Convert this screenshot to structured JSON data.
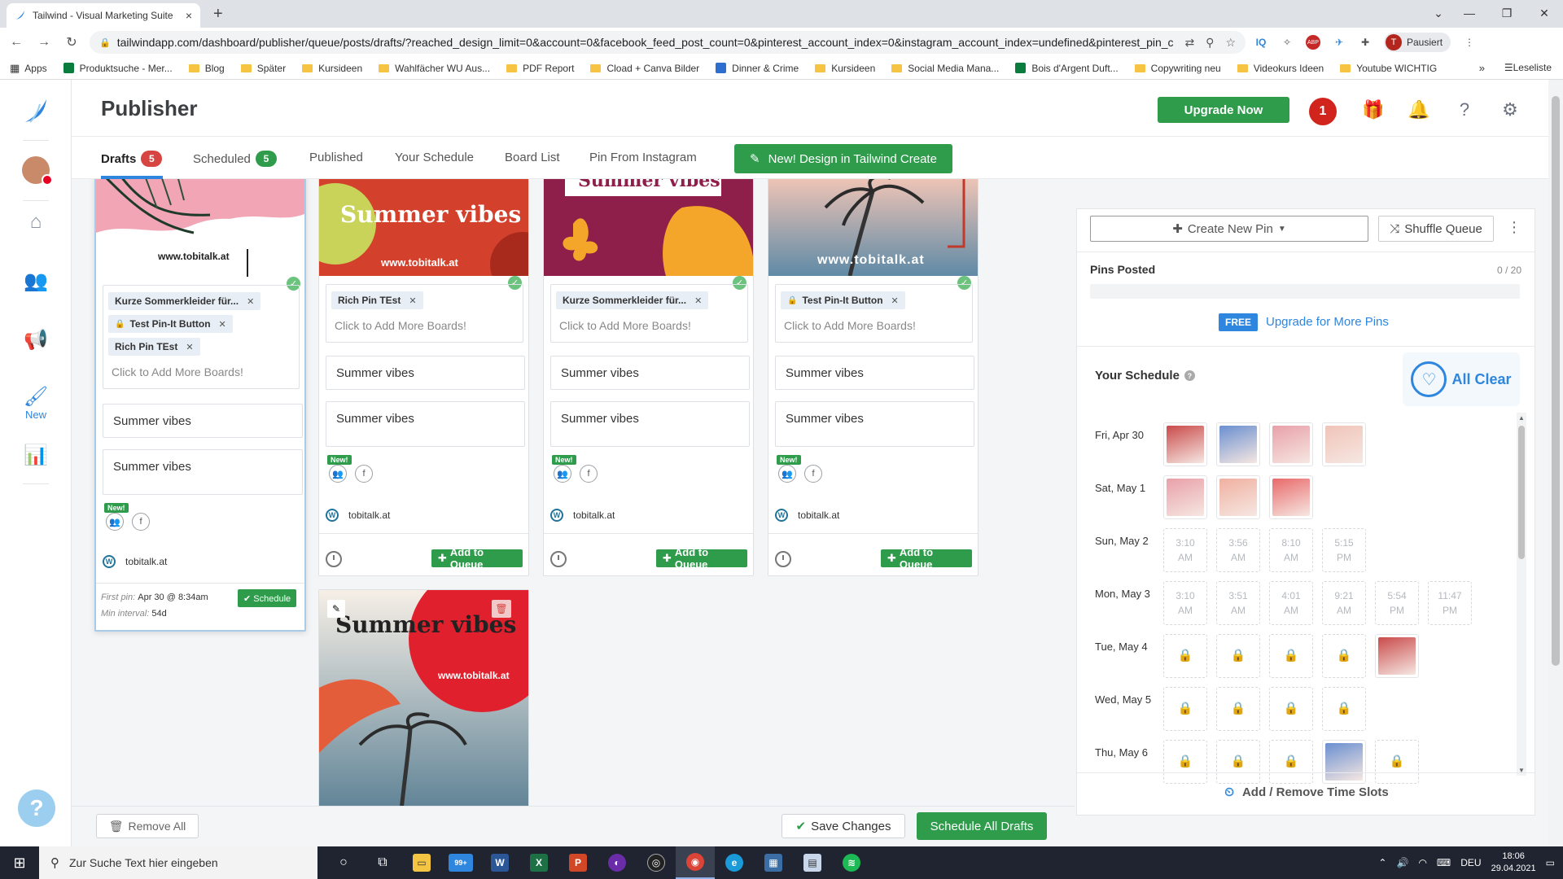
{
  "browser": {
    "tab_title": "Tailwind - Visual Marketing Suite",
    "tab_close": "×",
    "new_tab": "+",
    "url": "tailwindapp.com/dashboard/publisher/queue/posts/drafts/?reached_design_limit=0&account=0&facebook_feed_post_count=0&pinterest_account_index=0&instagram_account_index=undefined&pinterest_pin_count=5&i...",
    "profile_initial": "T",
    "profile_label": "Pausiert",
    "bookmarks": [
      {
        "label": "Apps",
        "kind": "apps"
      },
      {
        "label": "Produktsuche - Mer...",
        "kind": "page"
      },
      {
        "label": "Blog",
        "kind": "folder"
      },
      {
        "label": "Später",
        "kind": "folder"
      },
      {
        "label": "Kursideen",
        "kind": "folder"
      },
      {
        "label": "Wahlfächer WU Aus...",
        "kind": "folder"
      },
      {
        "label": "PDF Report",
        "kind": "folder"
      },
      {
        "label": "Cload + Canva Bilder",
        "kind": "folder"
      },
      {
        "label": "Dinner & Crime",
        "kind": "page-blue"
      },
      {
        "label": "Kursideen",
        "kind": "folder"
      },
      {
        "label": "Social Media Mana...",
        "kind": "folder"
      },
      {
        "label": "Bois d'Argent Duft...",
        "kind": "page"
      },
      {
        "label": "Copywriting neu",
        "kind": "folder"
      },
      {
        "label": "Videokurs Ideen",
        "kind": "folder"
      },
      {
        "label": "Youtube WICHTIG",
        "kind": "folder"
      }
    ],
    "bookmarks_more": "»",
    "reading_list": "Leseliste"
  },
  "header": {
    "title": "Publisher",
    "upgrade_label": "Upgrade Now",
    "notification_count": "1"
  },
  "subnav": {
    "tabs": [
      {
        "label": "Drafts",
        "count": "5"
      },
      {
        "label": "Scheduled",
        "count": "5"
      },
      {
        "label": "Published"
      },
      {
        "label": "Your Schedule"
      },
      {
        "label": "Board List"
      },
      {
        "label": "Pin From Instagram"
      }
    ],
    "new_design_label": "New! Design in Tailwind Create"
  },
  "cards": [
    {
      "image_text": "www.tobitalk.at",
      "boards": [
        {
          "label": "Kurze Sommerkleider für...",
          "locked": false
        },
        {
          "label": "Test Pin-It Button",
          "locked": true
        },
        {
          "label": "Rich Pin TEst",
          "locked": false
        }
      ],
      "boards_placeholder": "Click to Add More Boards!",
      "title": "Summer vibes",
      "description": "Summer vibes",
      "new_tag": "New!",
      "site": "tobitalk.at",
      "first_pin_label": "First pin:",
      "first_pin_value": "Apr 30 @ 8:34am",
      "interval_label": "Min interval:",
      "interval_value": "54d",
      "schedule_label": "✔ Schedule"
    },
    {
      "image_text": "Summer vibes",
      "image_url_text": "www.tobitalk.at",
      "boards": [
        {
          "label": "Rich Pin TEst",
          "locked": false
        }
      ],
      "boards_placeholder": "Click to Add More Boards!",
      "title": "Summer vibes",
      "description": "Summer vibes",
      "new_tag": "New!",
      "site": "tobitalk.at",
      "add_queue_label": "Add to Queue"
    },
    {
      "image_text": "Summer vibes",
      "boards": [
        {
          "label": "Kurze Sommerkleider für...",
          "locked": false
        }
      ],
      "boards_placeholder": "Click to Add More Boards!",
      "title": "Summer vibes",
      "description": "Summer vibes",
      "new_tag": "New!",
      "site": "tobitalk.at",
      "add_queue_label": "Add to Queue"
    },
    {
      "image_text": "www.tobitalk.at",
      "boards": [
        {
          "label": "Test Pin-It Button",
          "locked": true
        }
      ],
      "boards_placeholder": "Click to Add More Boards!",
      "title": "Summer vibes",
      "description": "Summer vibes",
      "new_tag": "New!",
      "site": "tobitalk.at",
      "add_queue_label": "Add to Queue"
    },
    {
      "image_text": "Summer vibes",
      "image_url_text": "www.tobitalk.at"
    }
  ],
  "bottombar": {
    "remove_all": "Remove All",
    "save_changes": "Save Changes",
    "schedule_all": "Schedule All Drafts"
  },
  "panel": {
    "create_pin": "Create New Pin",
    "shuffle": "Shuffle Queue",
    "pins_posted_title": "Pins Posted",
    "pins_posted_count": "0 / 20",
    "pins_posted_fraction": 0,
    "free_tag": "FREE",
    "upgrade_link": "Upgrade for More Pins",
    "schedule_title": "Your Schedule",
    "all_clear": "All Clear",
    "add_remove_slots": "Add / Remove Time Slots",
    "days": [
      {
        "day": "Fri, Apr 30",
        "slots": [
          {
            "type": "image",
            "color": "#c94b4b"
          },
          {
            "type": "image",
            "color": "#6a8fd0"
          },
          {
            "type": "image",
            "color": "#e8a0a8"
          },
          {
            "type": "image",
            "color": "#f0c4b8"
          }
        ]
      },
      {
        "day": "Sat, May 1",
        "slots": [
          {
            "type": "image",
            "color": "#e8a0a8"
          },
          {
            "type": "image",
            "color": "#f0b0a0"
          },
          {
            "type": "image",
            "color": "#e86a6a"
          }
        ]
      },
      {
        "day": "Sun, May 2",
        "slots": [
          {
            "type": "time",
            "t1": "3:10",
            "t2": "AM"
          },
          {
            "type": "time",
            "t1": "3:56",
            "t2": "AM"
          },
          {
            "type": "time",
            "t1": "8:10",
            "t2": "AM"
          },
          {
            "type": "time",
            "t1": "5:15",
            "t2": "PM"
          }
        ]
      },
      {
        "day": "Mon, May 3",
        "slots": [
          {
            "type": "time",
            "t1": "3:10",
            "t2": "AM"
          },
          {
            "type": "time",
            "t1": "3:51",
            "t2": "AM"
          },
          {
            "type": "time",
            "t1": "4:01",
            "t2": "AM"
          },
          {
            "type": "time",
            "t1": "9:21",
            "t2": "AM"
          },
          {
            "type": "time",
            "t1": "5:54",
            "t2": "PM"
          },
          {
            "type": "time",
            "t1": "11:47",
            "t2": "PM"
          }
        ]
      },
      {
        "day": "Tue, May 4",
        "slots": [
          {
            "type": "lock"
          },
          {
            "type": "lock"
          },
          {
            "type": "lock"
          },
          {
            "type": "lock"
          },
          {
            "type": "image",
            "color": "#c94b4b"
          }
        ]
      },
      {
        "day": "Wed, May 5",
        "slots": [
          {
            "type": "lock"
          },
          {
            "type": "lock"
          },
          {
            "type": "lock"
          },
          {
            "type": "lock"
          }
        ]
      },
      {
        "day": "Thu, May 6",
        "slots": [
          {
            "type": "lock"
          },
          {
            "type": "lock"
          },
          {
            "type": "lock"
          },
          {
            "type": "image",
            "color": "#6a8fd0"
          },
          {
            "type": "lock"
          }
        ]
      }
    ]
  },
  "taskbar": {
    "search_placeholder": "Zur Suche Text hier eingeben",
    "mail_badge": "99+",
    "lang": "DEU",
    "time": "18:06",
    "date": "29.04.2021"
  },
  "colors": {
    "green": "#2e9c4b",
    "blue": "#2e86de",
    "red": "#d0241c"
  }
}
